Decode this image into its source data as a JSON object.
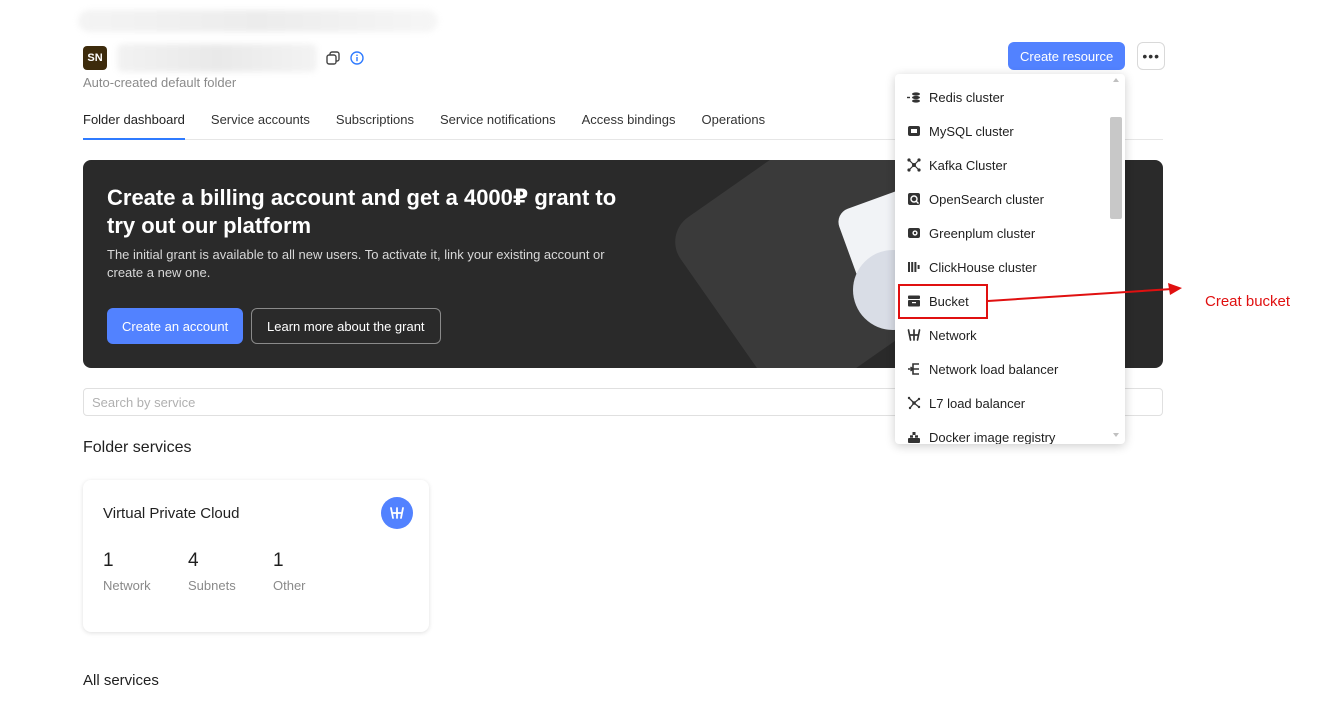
{
  "folder": {
    "avatar_initials": "SN",
    "description": "Auto-created default folder"
  },
  "tabs": [
    {
      "label": "Folder dashboard",
      "active": true
    },
    {
      "label": "Service accounts",
      "active": false
    },
    {
      "label": "Subscriptions",
      "active": false
    },
    {
      "label": "Service notifications",
      "active": false
    },
    {
      "label": "Access bindings",
      "active": false
    },
    {
      "label": "Operations",
      "active": false
    }
  ],
  "actions": {
    "create_resource_label": "Create resource",
    "more_label": "•••"
  },
  "banner": {
    "title": "Create a billing account and get a 4000₽ grant to try out our platform",
    "text": "The initial grant is available to all new users. To activate it, link your existing account or create a new one.",
    "primary_button": "Create an account",
    "secondary_button": "Learn more about the grant"
  },
  "search": {
    "placeholder": "Search by service"
  },
  "sections": {
    "folder_services": "Folder services",
    "all_services": "All services"
  },
  "service_card": {
    "title": "Virtual Private Cloud",
    "icon": "network-icon",
    "stats": [
      {
        "value": "1",
        "label": "Network"
      },
      {
        "value": "4",
        "label": "Subnets"
      },
      {
        "value": "1",
        "label": "Other"
      }
    ]
  },
  "dropdown": {
    "items": [
      {
        "label": "Redis cluster",
        "icon": "redis-icon"
      },
      {
        "label": "MySQL cluster",
        "icon": "mysql-icon"
      },
      {
        "label": "Kafka Cluster",
        "icon": "kafka-icon"
      },
      {
        "label": "OpenSearch cluster",
        "icon": "opensearch-icon"
      },
      {
        "label": "Greenplum cluster",
        "icon": "greenplum-icon"
      },
      {
        "label": "ClickHouse cluster",
        "icon": "clickhouse-icon"
      },
      {
        "label": "Bucket",
        "icon": "bucket-icon"
      },
      {
        "label": "Network",
        "icon": "network-icon"
      },
      {
        "label": "Network load balancer",
        "icon": "load-balancer-icon"
      },
      {
        "label": "L7 load balancer",
        "icon": "l7-balancer-icon"
      },
      {
        "label": "Docker image registry",
        "icon": "docker-registry-icon"
      }
    ]
  },
  "annotation": {
    "text": "Creat bucket",
    "color": "#e01010"
  },
  "colors": {
    "accent": "#5282ff",
    "banner_bg": "#2a2a2a"
  }
}
